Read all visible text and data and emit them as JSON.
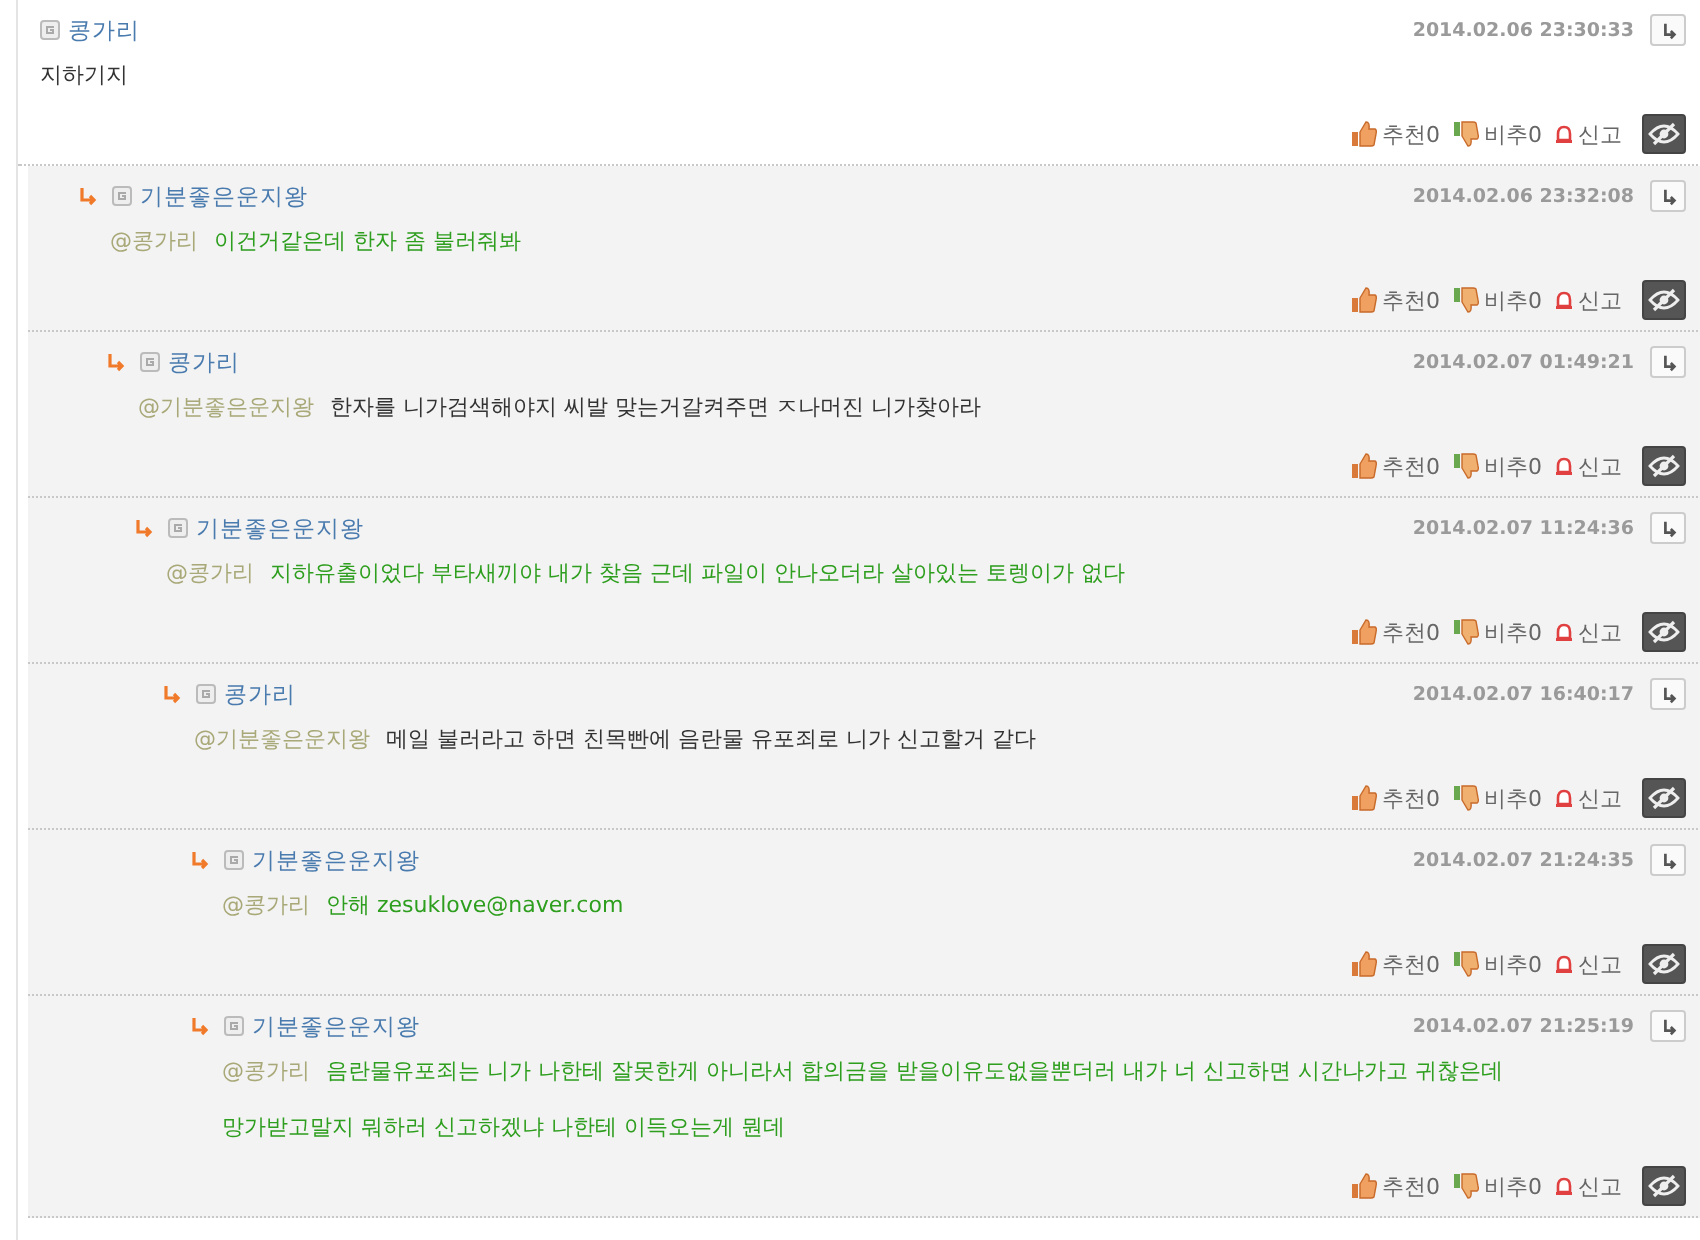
{
  "comments": [
    {
      "author": "콩가리",
      "date": "2014.02.06 23:30:33",
      "body": [
        "지하기지"
      ],
      "color": "#333333",
      "recommend": "추천0",
      "unrecommend": "비추0",
      "report": "신고",
      "children": [
        {
          "author": "기분좋은운지왕",
          "date": "2014.02.06 23:32:08",
          "mention": "@콩가리",
          "body": [
            "이건거같은데 한자 좀 불러줘봐"
          ],
          "color": "#2e9e1e",
          "recommend": "추천0",
          "unrecommend": "비추0",
          "report": "신고",
          "children": [
            {
              "author": "콩가리",
              "date": "2014.02.07 01:49:21",
              "mention": "@기분좋은운지왕",
              "body": [
                "한자를 니가검색해야지 씨발 맞는거갈켜주면 ㅈ나머진 니가찾아라"
              ],
              "color": "#333333",
              "recommend": "추천0",
              "unrecommend": "비추0",
              "report": "신고",
              "children": [
                {
                  "author": "기분좋은운지왕",
                  "date": "2014.02.07 11:24:36",
                  "mention": "@콩가리",
                  "body": [
                    "지하유출이었다 부타새끼야 내가 찾음 근데 파일이 안나오더라 살아있는 토렝이가 없다"
                  ],
                  "color": "#2e9e1e",
                  "recommend": "추천0",
                  "unrecommend": "비추0",
                  "report": "신고",
                  "children": [
                    {
                      "author": "콩가리",
                      "date": "2014.02.07 16:40:17",
                      "mention": "@기분좋은운지왕",
                      "body": [
                        "메일 불러라고 하면 친목빤에 음란물 유포죄로 니가 신고할거 같다"
                      ],
                      "color": "#333333",
                      "recommend": "추천0",
                      "unrecommend": "비추0",
                      "report": "신고",
                      "children": [
                        {
                          "author": "기분좋은운지왕",
                          "date": "2014.02.07 21:24:35",
                          "mention": "@콩가리",
                          "body": [
                            "안해 zesuklove@naver.com"
                          ],
                          "color": "#2e9e1e",
                          "recommend": "추천0",
                          "unrecommend": "비추0",
                          "report": "신고"
                        },
                        {
                          "author": "기분좋은운지왕",
                          "date": "2014.02.07 21:25:19",
                          "mention": "@콩가리",
                          "body": [
                            "음란물유포죄는 니가 나한테 잘못한게 아니라서 합의금을 받을이유도없을뿐더러 내가 너 신고하면 시간나가고 귀찮은데",
                            "망가받고말지 뭐하러 신고하겠냐 나한테 이득오는게 뭔데"
                          ],
                          "color": "#2e9e1e",
                          "recommend": "추천0",
                          "unrecommend": "비추0",
                          "report": "신고"
                        }
                      ]
                    }
                  ]
                }
              ]
            }
          ]
        }
      ]
    }
  ]
}
